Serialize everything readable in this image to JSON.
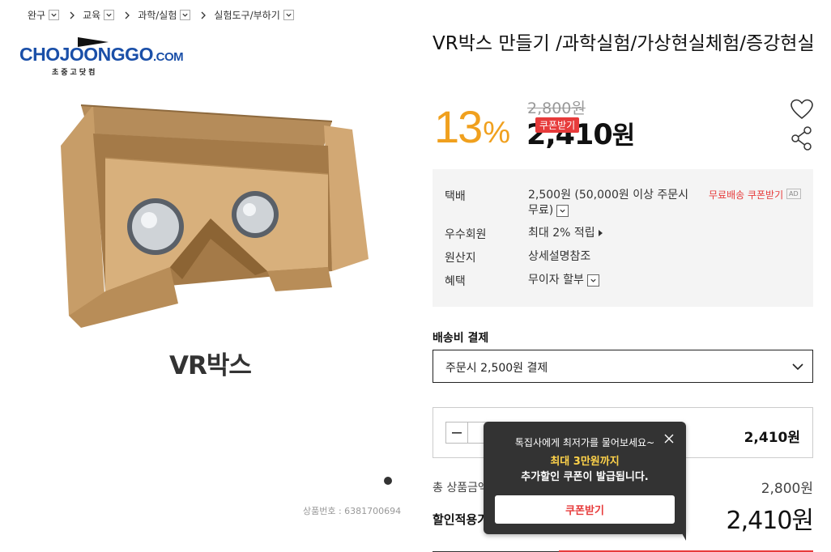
{
  "breadcrumb": [
    {
      "label": "완구"
    },
    {
      "label": "교육"
    },
    {
      "label": "과학/실험"
    },
    {
      "label": "실험도구/부하기"
    }
  ],
  "logo": {
    "main": "CHOJOONGGO",
    "domain": ".COM",
    "sub": "초중고닷컴"
  },
  "product": {
    "caption": "VR박스",
    "product_no": "상품번호 : 6381700694",
    "title": "VR박스 만들기 /과학실험/가상현실체험/증강현실",
    "discount": "13",
    "discount_unit": "%",
    "original_price": "2,800원",
    "sale_price_num": "2,410",
    "sale_price_unit": "원",
    "coupon_tag": "쿠폰받기"
  },
  "info": {
    "rows": [
      {
        "label": "택배",
        "value": "2,500원 (50,000원 이상 주문시 무료)"
      },
      {
        "label": "우수회원",
        "value": "최대 2% 적립"
      },
      {
        "label": "원산지",
        "value": "상세설명참조"
      },
      {
        "label": "혜택",
        "value": "무이자 할부"
      }
    ],
    "free_ship_coupon": "무료배송 쿠폰받기",
    "ad_badge": "AD"
  },
  "shipping": {
    "label": "배송비 결제",
    "selected": "주문시 2,500원 결제"
  },
  "quantity": {
    "price": "2,410원"
  },
  "totals": {
    "total_label": "총 상품금액",
    "total_value": "2,800원",
    "final_label": "할인적용가",
    "final_value": "2,410원"
  },
  "tooltip": {
    "line1": "톡집사에게 최저가를 물어보세요~",
    "line2": "최대 3만원까지",
    "line3": "추가할인 쿠폰이 발급됩니다.",
    "button": "쿠폰받기"
  },
  "colors": {
    "accent_orange": "#f0a01e",
    "accent_red": "#e73b3b",
    "tooltip_bg": "#333333"
  }
}
